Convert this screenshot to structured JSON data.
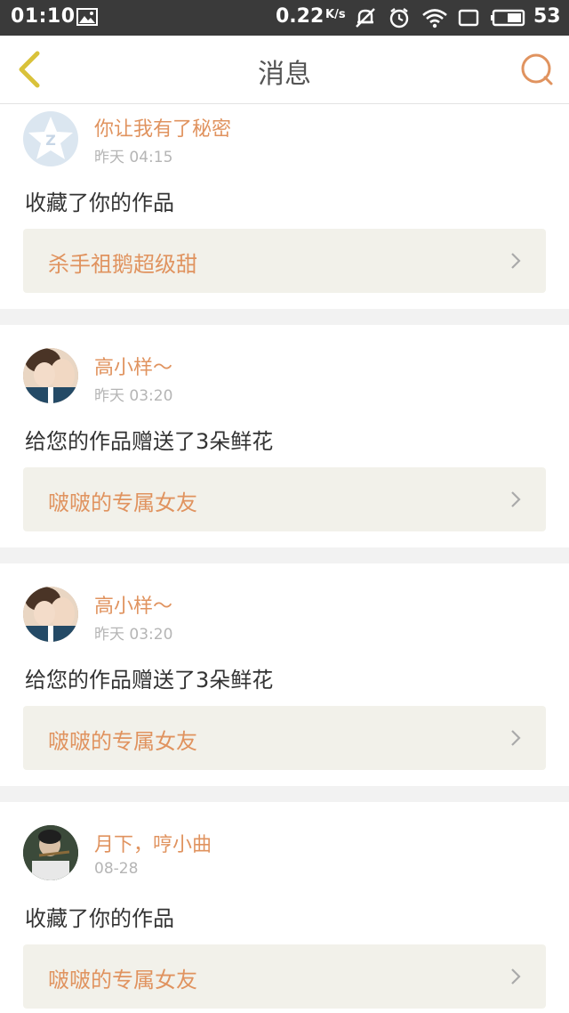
{
  "status_bar": {
    "time": "01:10",
    "speed": "0.22",
    "speed_unit": "K/s",
    "battery": "53"
  },
  "header": {
    "title": "消息"
  },
  "messages": [
    {
      "name": "你让我有了秘密",
      "time": "昨天 04:15",
      "action": "收藏了你的作品",
      "work": "杀手祖鹅超级甜",
      "avatar": "qzone-star-icon"
    },
    {
      "name": "高小样～",
      "time": "昨天 03:20",
      "action": "给您的作品赠送了3朵鲜花",
      "work": "啵啵的专属女友",
      "avatar": "user-photo"
    },
    {
      "name": "高小样～",
      "time": "昨天 03:20",
      "action": "给您的作品赠送了3朵鲜花",
      "work": "啵啵的专属女友",
      "avatar": "user-photo"
    },
    {
      "name": "月下，哼小曲",
      "time": "08-28",
      "action": "收藏了你的作品",
      "work": "啵啵的专属女友",
      "avatar": "user-photo"
    }
  ],
  "colors": {
    "accent": "#e0935f",
    "back_icon": "#d9c23a",
    "status_bar": "#3a3a3a"
  }
}
